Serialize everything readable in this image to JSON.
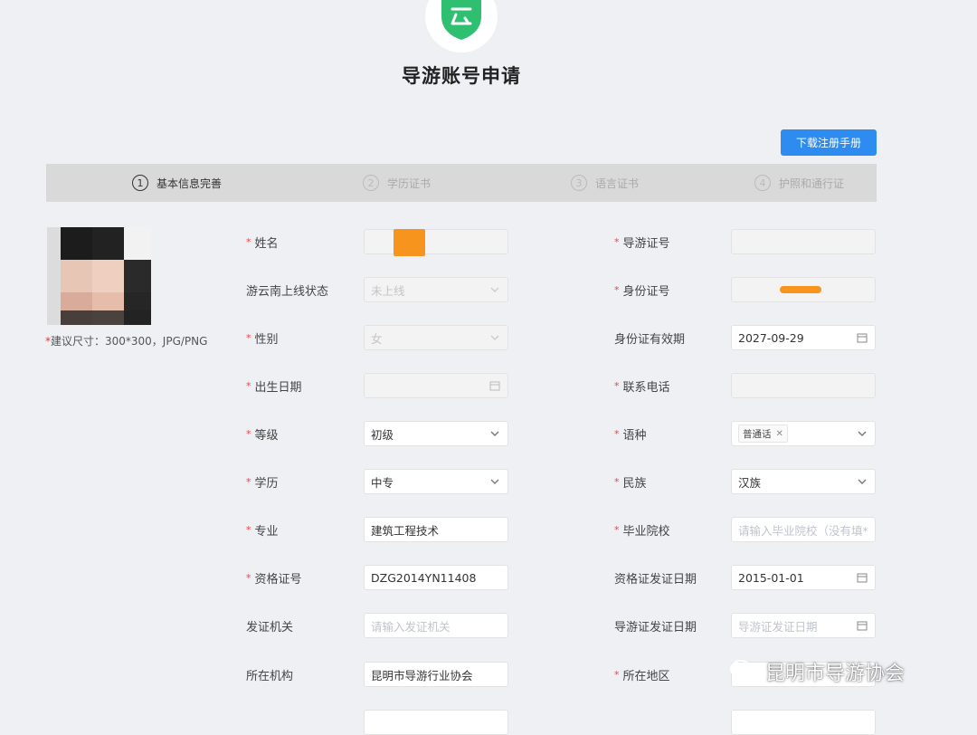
{
  "header": {
    "title": "导游账号申请",
    "download_label": "下载注册手册"
  },
  "colors": {
    "accent": "#2e8cf0",
    "required": "#e44444",
    "logo_green": "#2fbf71",
    "redaction": "#f7941d"
  },
  "steps": [
    {
      "num": "1",
      "label": "基本信息完善"
    },
    {
      "num": "2",
      "label": "学历证书"
    },
    {
      "num": "3",
      "label": "语言证书"
    },
    {
      "num": "4",
      "label": "护照和通行证"
    }
  ],
  "avatar": {
    "hint_star": "*",
    "hint": "建议尺寸：300*300，JPG/PNG"
  },
  "form": {
    "name": {
      "label": "姓名",
      "value": ""
    },
    "online_status": {
      "label": "游云南上线状态",
      "value": "未上线"
    },
    "gender": {
      "label": "性别",
      "value": "女"
    },
    "birth_date": {
      "label": "出生日期",
      "value": ""
    },
    "level": {
      "label": "等级",
      "value": "初级"
    },
    "education": {
      "label": "学历",
      "value": "中专"
    },
    "major": {
      "label": "专业",
      "value": "建筑工程技术"
    },
    "qualification_no": {
      "label": "资格证号",
      "value": "DZG2014YN11408"
    },
    "issuing_authority": {
      "label": "发证机关",
      "placeholder": "请输入发证机关"
    },
    "organization": {
      "label": "所在机构",
      "value": "昆明市导游行业协会"
    },
    "guide_cert_no": {
      "label": "导游证号",
      "value": ""
    },
    "id_no": {
      "label": "身份证号",
      "value": ""
    },
    "id_validity": {
      "label": "身份证有效期",
      "value": "2027-09-29"
    },
    "phone": {
      "label": "联系电话",
      "value": ""
    },
    "language": {
      "label": "语种",
      "tag": "普通话"
    },
    "ethnicity": {
      "label": "民族",
      "value": "汉族"
    },
    "school": {
      "label": "毕业院校",
      "placeholder": "请输入毕业院校（没有填*"
    },
    "qual_issue_date": {
      "label": "资格证发证日期",
      "value": "2015-01-01"
    },
    "guide_issue_date": {
      "label": "导游证发证日期",
      "placeholder": "导游证发证日期"
    },
    "region": {
      "label": "所在地区",
      "value": ""
    }
  },
  "watermark": {
    "text": "昆明市导游协会"
  }
}
